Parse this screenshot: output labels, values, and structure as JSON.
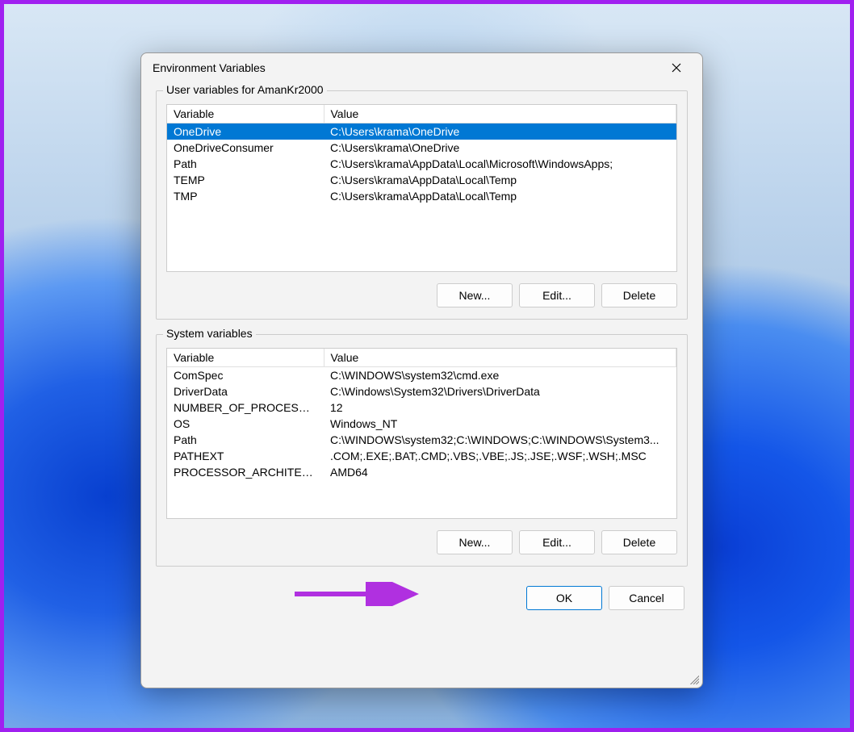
{
  "dialog": {
    "title": "Environment Variables",
    "user_section_label": "User variables for AmanKr2000",
    "system_section_label": "System variables",
    "columns": {
      "variable": "Variable",
      "value": "Value"
    },
    "user_vars": [
      {
        "name": "OneDrive",
        "value": "C:\\Users\\krama\\OneDrive",
        "selected": true
      },
      {
        "name": "OneDriveConsumer",
        "value": "C:\\Users\\krama\\OneDrive"
      },
      {
        "name": "Path",
        "value": "C:\\Users\\krama\\AppData\\Local\\Microsoft\\WindowsApps;"
      },
      {
        "name": "TEMP",
        "value": "C:\\Users\\krama\\AppData\\Local\\Temp"
      },
      {
        "name": "TMP",
        "value": "C:\\Users\\krama\\AppData\\Local\\Temp"
      }
    ],
    "system_vars": [
      {
        "name": "ComSpec",
        "value": "C:\\WINDOWS\\system32\\cmd.exe"
      },
      {
        "name": "DriverData",
        "value": "C:\\Windows\\System32\\Drivers\\DriverData"
      },
      {
        "name": "NUMBER_OF_PROCESSORS",
        "value": "12"
      },
      {
        "name": "OS",
        "value": "Windows_NT"
      },
      {
        "name": "Path",
        "value": "C:\\WINDOWS\\system32;C:\\WINDOWS;C:\\WINDOWS\\System3..."
      },
      {
        "name": "PATHEXT",
        "value": ".COM;.EXE;.BAT;.CMD;.VBS;.VBE;.JS;.JSE;.WSF;.WSH;.MSC"
      },
      {
        "name": "PROCESSOR_ARCHITECTU...",
        "value": "AMD64"
      }
    ],
    "buttons": {
      "new": "New...",
      "edit": "Edit...",
      "delete": "Delete",
      "ok": "OK",
      "cancel": "Cancel"
    }
  },
  "annotation": {
    "arrow_color": "#b030e0"
  }
}
